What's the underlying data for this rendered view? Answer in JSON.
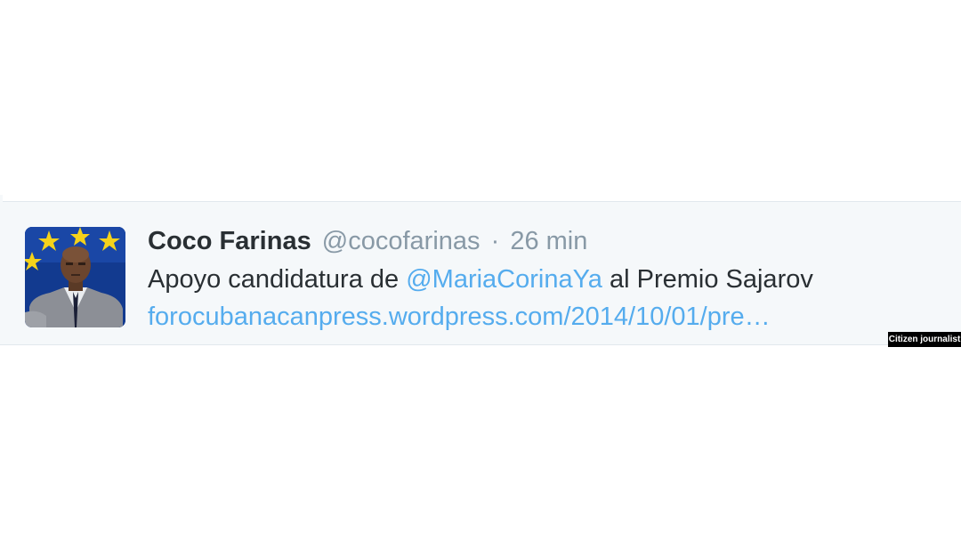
{
  "tweet": {
    "author_name": "Coco Farinas",
    "author_handle": "@cocofarinas",
    "separator": "·",
    "timestamp": "26 min",
    "text_prefix": "Apoyo candidatura de ",
    "mention": "@MariaCorinaYa",
    "text_suffix": " al Premio Sajarov",
    "link": "forocubanacanpress.wordpress.com/2014/10/01/pre…"
  },
  "credit": {
    "label": "Citizen journalist"
  },
  "colors": {
    "background": "#ffffff",
    "tweet_background": "#f5f8fa",
    "accent_link": "#55acee",
    "name_text": "#292f33",
    "muted_text": "#8899a6",
    "credit_background": "#000000"
  }
}
